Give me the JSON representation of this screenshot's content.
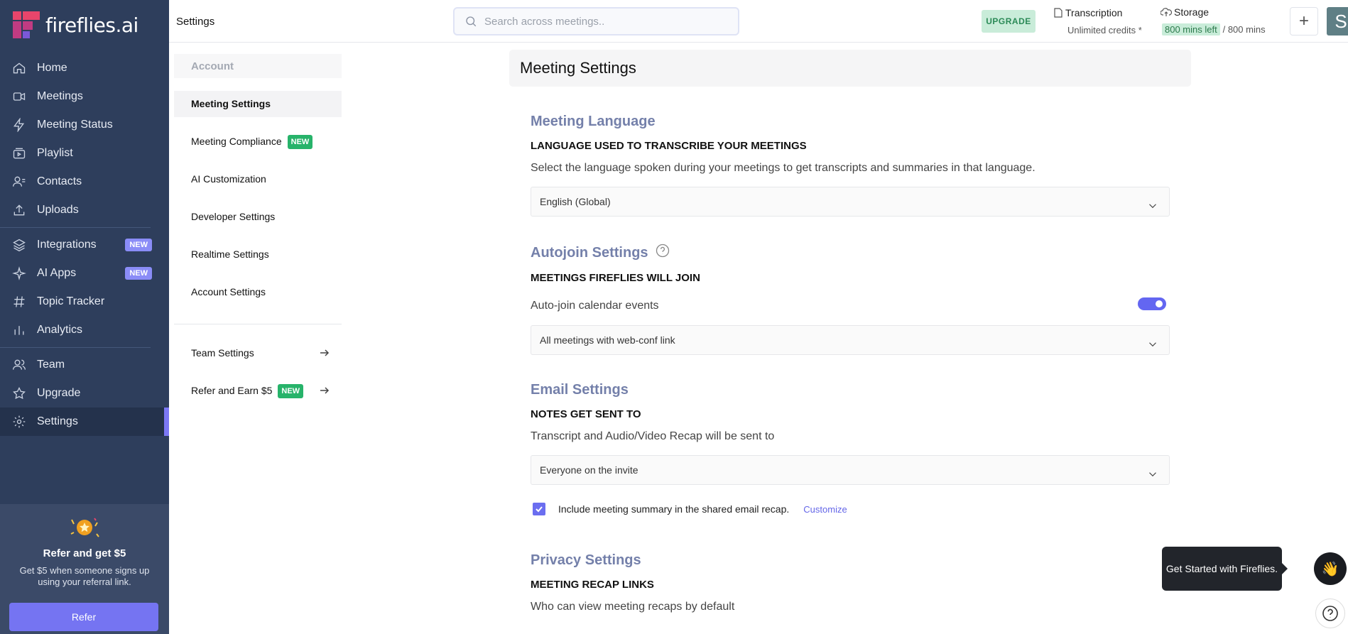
{
  "brand": {
    "name": "fireflies.ai",
    "logo_colors": [
      "#e8456b",
      "#c13b82",
      "#7a58d8"
    ]
  },
  "colors": {
    "sidebar_bg": "#2e3e5c",
    "accent": "#7c78f5",
    "section_title": "#7480aa",
    "new_badge_green": "#27b36a"
  },
  "sidebar": {
    "items": [
      {
        "label": "Home",
        "icon": "home-icon"
      },
      {
        "label": "Meetings",
        "icon": "video-icon"
      },
      {
        "label": "Meeting Status",
        "icon": "bolt-icon"
      },
      {
        "label": "Playlist",
        "icon": "playlist-icon"
      },
      {
        "label": "Contacts",
        "icon": "contacts-icon"
      },
      {
        "label": "Uploads",
        "icon": "upload-icon"
      },
      {
        "label": "Integrations",
        "icon": "layers-icon",
        "badge": "NEW"
      },
      {
        "label": "AI Apps",
        "icon": "sparkle-icon",
        "badge": "NEW"
      },
      {
        "label": "Topic Tracker",
        "icon": "hash-icon"
      },
      {
        "label": "Analytics",
        "icon": "chart-icon"
      },
      {
        "label": "Team",
        "icon": "team-icon"
      },
      {
        "label": "Upgrade",
        "icon": "star-icon"
      },
      {
        "label": "Settings",
        "icon": "gear-icon",
        "active": true
      }
    ],
    "refer": {
      "title": "Refer and get $5",
      "description": "Get $5 when someone signs up using your referral link.",
      "button": "Refer"
    }
  },
  "topbar": {
    "page_label": "Settings",
    "search_placeholder": "Search across meetings..",
    "upgrade": "UPGRADE",
    "transcription_label": "Transcription",
    "transcription_value": "Unlimited credits *",
    "storage_label": "Storage",
    "storage_left": "800 mins left",
    "storage_total": "/ 800 mins",
    "avatar_initial": "S"
  },
  "subnav": {
    "header": "Account",
    "items": [
      {
        "label": "Meeting Settings",
        "active": true
      },
      {
        "label": "Meeting Compliance",
        "badge": "NEW"
      },
      {
        "label": "AI Customization"
      },
      {
        "label": "Developer Settings"
      },
      {
        "label": "Realtime Settings"
      },
      {
        "label": "Account Settings"
      }
    ],
    "links": [
      {
        "label": "Team Settings"
      },
      {
        "label": "Refer and Earn $5",
        "badge": "NEW"
      }
    ]
  },
  "main": {
    "heading": "Meeting Settings",
    "language": {
      "title": "Meeting Language",
      "subtitle": "LANGUAGE USED TO TRANSCRIBE YOUR MEETINGS",
      "description": "Select the language spoken during your meetings to get transcripts and summaries in that language.",
      "selected": "English (Global)"
    },
    "autojoin": {
      "title": "Autojoin Settings",
      "subtitle": "MEETINGS FIREFLIES WILL JOIN",
      "toggle_label": "Auto-join calendar events",
      "toggle_on": true,
      "selected": "All meetings with web-conf link"
    },
    "email": {
      "title": "Email Settings",
      "subtitle": "NOTES GET SENT TO",
      "description": "Transcript and Audio/Video Recap will be sent to",
      "selected": "Everyone on the invite",
      "checkbox_label": "Include meeting summary in the shared email recap.",
      "checkbox_checked": true,
      "customize": "Customize"
    },
    "privacy": {
      "title": "Privacy Settings",
      "subtitle": "MEETING RECAP LINKS",
      "description": "Who can view meeting recaps by default"
    }
  },
  "toast": {
    "text": "Get Started with Fireflies.",
    "emoji": "👋"
  }
}
